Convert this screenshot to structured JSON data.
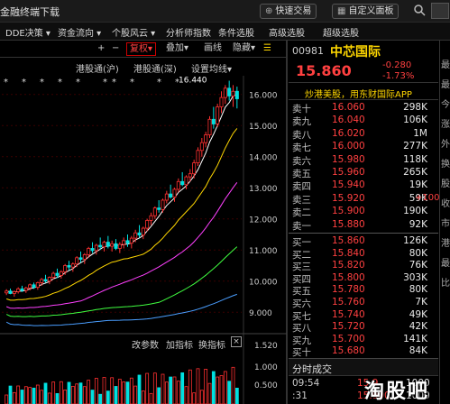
{
  "app_title": "金融终端下载",
  "titlebar": {
    "quick_trade": "快速交易",
    "custom_panel": "自定义面板",
    "search_icon": "search-icon",
    "quick_trade_icon": "globe-icon",
    "custom_panel_icon": "grid-icon"
  },
  "menu": [
    "DDE决策",
    "资金流向",
    "个股风云",
    "分析师指数",
    "条件选股",
    "高级选股",
    "超级选股"
  ],
  "chart_toolbar": {
    "plus": "+",
    "minus": "−",
    "adjust": "复权",
    "overlay": "叠加",
    "draw": "画线",
    "hide": "隐藏"
  },
  "chart_header": {
    "hk1": "港股通(沪)",
    "hk2": "港股通(深)",
    "ma_setting": "设置均线"
  },
  "chart_data": {
    "type": "candlestick",
    "ylim": [
      8.6,
      16.6
    ],
    "y_ticks": [
      "16.000",
      "15.000",
      "14.000",
      "13.000",
      "12.000",
      "11.000",
      "10.000",
      "9.000"
    ],
    "peak_label": "16.440",
    "candles": [
      [
        9.62,
        9.74,
        9.55,
        9.68
      ],
      [
        9.68,
        9.76,
        9.58,
        9.6
      ],
      [
        9.6,
        9.7,
        9.5,
        9.66
      ],
      [
        9.66,
        9.8,
        9.6,
        9.75
      ],
      [
        9.75,
        9.85,
        9.65,
        9.7
      ],
      [
        9.7,
        9.82,
        9.62,
        9.78
      ],
      [
        9.78,
        9.92,
        9.7,
        9.88
      ],
      [
        9.88,
        9.95,
        9.75,
        9.8
      ],
      [
        9.8,
        9.98,
        9.72,
        9.95
      ],
      [
        9.95,
        10.1,
        9.85,
        10.05
      ],
      [
        10.05,
        10.2,
        9.95,
        10.0
      ],
      [
        10.0,
        10.15,
        9.9,
        10.12
      ],
      [
        10.12,
        10.3,
        10.05,
        10.25
      ],
      [
        10.25,
        10.4,
        10.1,
        10.18
      ],
      [
        10.18,
        10.35,
        10.08,
        10.3
      ],
      [
        10.3,
        10.55,
        10.2,
        10.5
      ],
      [
        10.5,
        10.65,
        10.35,
        10.45
      ],
      [
        10.45,
        10.6,
        10.3,
        10.55
      ],
      [
        10.55,
        10.8,
        10.45,
        10.75
      ],
      [
        10.75,
        10.95,
        10.6,
        10.7
      ],
      [
        10.7,
        10.9,
        10.55,
        10.85
      ],
      [
        10.85,
        11.1,
        10.75,
        11.05
      ],
      [
        11.05,
        11.25,
        10.9,
        10.98
      ],
      [
        10.98,
        11.2,
        10.85,
        11.15
      ],
      [
        11.15,
        11.4,
        11.0,
        11.1
      ],
      [
        11.1,
        11.3,
        10.95,
        11.25
      ],
      [
        11.25,
        11.45,
        11.05,
        11.12
      ],
      [
        11.12,
        11.3,
        10.95,
        11.2
      ],
      [
        11.2,
        11.35,
        11.0,
        11.05
      ],
      [
        11.05,
        11.25,
        10.9,
        11.18
      ],
      [
        11.18,
        11.4,
        11.05,
        11.3
      ],
      [
        11.3,
        11.5,
        11.1,
        11.22
      ],
      [
        11.22,
        11.45,
        11.05,
        11.38
      ],
      [
        11.38,
        11.65,
        11.25,
        11.55
      ],
      [
        11.55,
        11.8,
        11.4,
        11.48
      ],
      [
        11.48,
        11.75,
        11.35,
        11.7
      ],
      [
        11.7,
        12.0,
        11.6,
        11.95
      ],
      [
        11.95,
        12.2,
        11.8,
        12.1
      ],
      [
        12.1,
        12.4,
        12.0,
        12.35
      ],
      [
        12.35,
        12.6,
        12.2,
        12.3
      ],
      [
        12.3,
        12.65,
        12.2,
        12.6
      ],
      [
        12.6,
        12.9,
        12.5,
        12.8
      ],
      [
        12.8,
        13.1,
        12.65,
        12.7
      ],
      [
        12.7,
        13.0,
        12.55,
        12.95
      ],
      [
        12.95,
        13.3,
        12.85,
        13.2
      ],
      [
        13.2,
        13.5,
        13.05,
        13.1
      ],
      [
        13.1,
        13.4,
        12.95,
        13.35
      ],
      [
        13.35,
        13.6,
        13.2,
        13.45
      ],
      [
        13.45,
        13.9,
        13.3,
        13.8
      ],
      [
        13.8,
        14.3,
        13.7,
        14.2
      ],
      [
        14.2,
        14.6,
        14.0,
        14.45
      ],
      [
        14.45,
        14.8,
        14.3,
        14.7
      ],
      [
        14.7,
        15.3,
        14.6,
        15.2
      ],
      [
        15.2,
        15.6,
        14.9,
        15.05
      ],
      [
        15.05,
        15.7,
        14.95,
        15.6
      ],
      [
        15.6,
        16.1,
        15.4,
        15.9
      ],
      [
        15.9,
        16.3,
        15.7,
        16.2
      ],
      [
        16.2,
        16.44,
        15.8,
        15.95
      ],
      [
        15.95,
        16.3,
        15.6,
        16.1
      ],
      [
        16.1,
        16.25,
        15.55,
        15.86
      ]
    ],
    "ma_colors": [
      "#ffffff",
      "#ffd700",
      "#ff40ff",
      "#40ff40",
      "#4a9eff"
    ]
  },
  "volume": {
    "change_params": "改参数",
    "add_indicator": "加指标",
    "switch_indicator": "换指标",
    "y_ticks": [
      "1.520",
      "1.000",
      "0.500"
    ]
  },
  "quote": {
    "code": "00981",
    "name": "中芯国际",
    "price": "15.860",
    "change": "-0.280",
    "change_pct": "-1.73%",
    "promo": "炒港美股，用东财国际APP",
    "sell": [
      {
        "label": "卖十",
        "price": "16.060",
        "vol": "298K"
      },
      {
        "label": "卖九",
        "price": "16.040",
        "vol": "106K"
      },
      {
        "label": "卖八",
        "price": "16.020",
        "vol": "1M"
      },
      {
        "label": "卖七",
        "price": "16.000",
        "vol": "277K"
      },
      {
        "label": "卖六",
        "price": "15.980",
        "vol": "118K"
      },
      {
        "label": "卖五",
        "price": "15.960",
        "vol": "265K"
      },
      {
        "label": "卖四",
        "price": "15.940",
        "vol": "19K"
      },
      {
        "label": "卖三",
        "price": "15.920",
        "vol": "59K",
        "chg": "+1000"
      },
      {
        "label": "卖二",
        "price": "15.900",
        "vol": "190K"
      },
      {
        "label": "卖一",
        "price": "15.880",
        "vol": "92K"
      }
    ],
    "buy": [
      {
        "label": "买一",
        "price": "15.860",
        "vol": "126K"
      },
      {
        "label": "买二",
        "price": "15.840",
        "vol": "80K"
      },
      {
        "label": "买三",
        "price": "15.820",
        "vol": "76K"
      },
      {
        "label": "买四",
        "price": "15.800",
        "vol": "303K"
      },
      {
        "label": "买五",
        "price": "15.780",
        "vol": "80K"
      },
      {
        "label": "买六",
        "price": "15.760",
        "vol": "7K"
      },
      {
        "label": "买七",
        "price": "15.740",
        "vol": "49K"
      },
      {
        "label": "买八",
        "price": "15.720",
        "vol": "42K"
      },
      {
        "label": "买九",
        "price": "15.700",
        "vol": "141K"
      },
      {
        "label": "买十",
        "price": "15.680",
        "vol": "84K"
      }
    ],
    "ticks_title": "分时成交",
    "ticks": [
      {
        "time": "09:54",
        "price": "15.9",
        "vol": "1000"
      },
      {
        "time": ":31",
        "price": "15.900",
        "vol": "1000"
      }
    ]
  },
  "right_strip": [
    "最",
    "最",
    "今",
    "涨",
    "外",
    "换",
    "股",
    "收",
    "市",
    "港",
    "最",
    "比"
  ],
  "watermark": "淘股吧"
}
